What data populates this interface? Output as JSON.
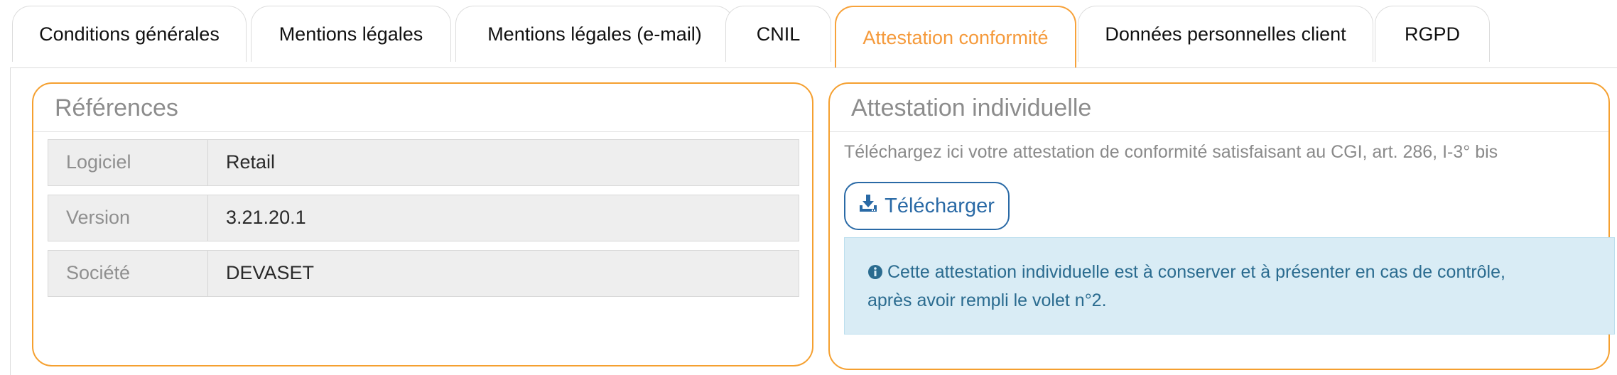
{
  "tabs": [
    {
      "label": "Conditions générales",
      "active": false
    },
    {
      "label": "Mentions légales",
      "active": false
    },
    {
      "label": "Mentions légales (e-mail)",
      "active": false
    },
    {
      "label": "CNIL",
      "active": false
    },
    {
      "label": "Attestation conformité",
      "active": true
    },
    {
      "label": "Données personnelles client",
      "active": false
    },
    {
      "label": "RGPD",
      "active": false
    }
  ],
  "references": {
    "title": "Références",
    "rows": [
      {
        "key": "Logiciel",
        "value": "Retail"
      },
      {
        "key": "Version",
        "value": "3.21.20.1"
      },
      {
        "key": "Société",
        "value": "DEVASET"
      }
    ]
  },
  "attestation": {
    "title": "Attestation individuelle",
    "description": "Téléchargez ici votre attestation de conformité satisfaisant au CGI, art. 286, I-3° bis",
    "download_label": "Télécharger",
    "info_line1": "Cette attestation individuelle est à conserver et à présenter en cas de contrôle,",
    "info_line2": "après avoir rempli le volet n°2."
  },
  "colors": {
    "accent_orange": "#f5a030",
    "link_blue": "#2a6aa6",
    "info_bg": "#d9ecf5",
    "info_text": "#2a6b8f"
  },
  "icons": {
    "download": "download-icon",
    "info": "info-circle-icon"
  }
}
